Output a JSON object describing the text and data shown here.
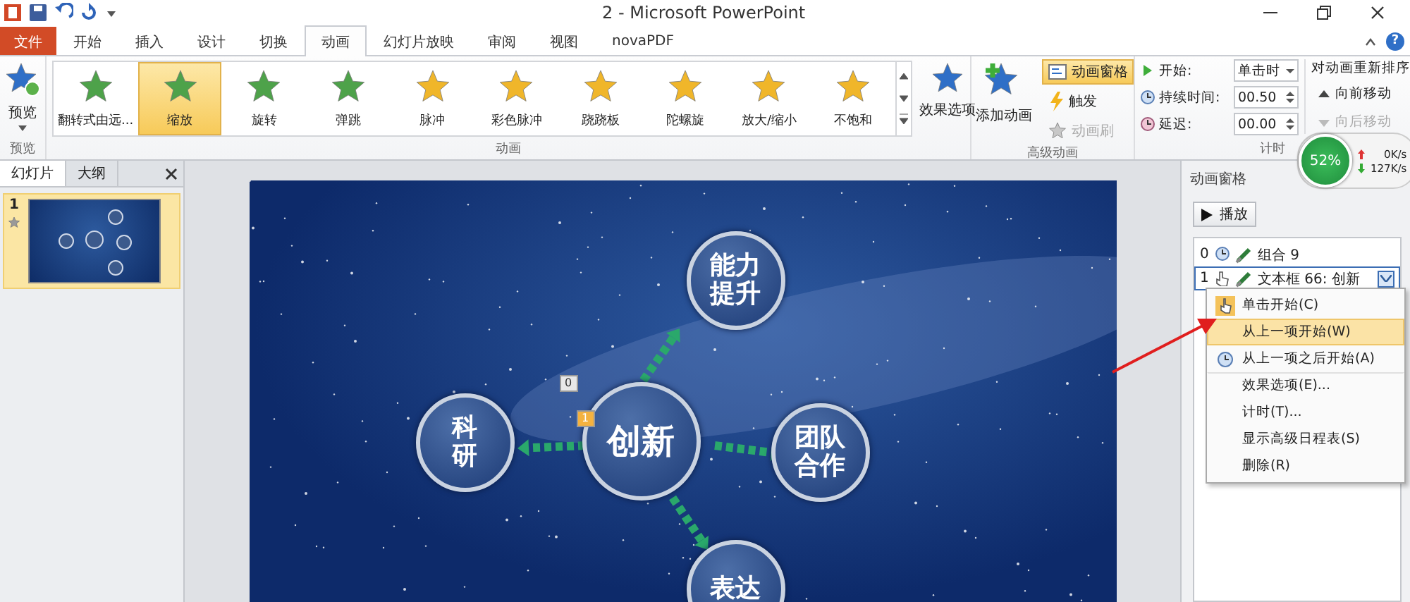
{
  "window": {
    "title": "2 - Microsoft PowerPoint"
  },
  "help": "?",
  "tabs": [
    {
      "label": "文件",
      "kind": "file",
      "selected": false
    },
    {
      "label": "开始",
      "kind": "tab",
      "selected": false
    },
    {
      "label": "插入",
      "kind": "tab",
      "selected": false
    },
    {
      "label": "设计",
      "kind": "tab",
      "selected": false
    },
    {
      "label": "切换",
      "kind": "tab",
      "selected": false
    },
    {
      "label": "动画",
      "kind": "tab",
      "selected": true
    },
    {
      "label": "幻灯片放映",
      "kind": "tab",
      "selected": false
    },
    {
      "label": "审阅",
      "kind": "tab",
      "selected": false
    },
    {
      "label": "视图",
      "kind": "tab",
      "selected": false
    },
    {
      "label": "novaPDF",
      "kind": "tab",
      "selected": false
    }
  ],
  "ribbon": {
    "preview": {
      "label": "预览",
      "group": "预览"
    },
    "gallery": {
      "group": "动画",
      "items": [
        {
          "label": "翻转式由远...",
          "kind": "entrance",
          "selected": false
        },
        {
          "label": "缩放",
          "kind": "entrance",
          "selected": true
        },
        {
          "label": "旋转",
          "kind": "entrance",
          "selected": false
        },
        {
          "label": "弹跳",
          "kind": "entrance",
          "selected": false
        },
        {
          "label": "脉冲",
          "kind": "emphasis",
          "selected": false
        },
        {
          "label": "彩色脉冲",
          "kind": "emphasis",
          "selected": false
        },
        {
          "label": "跷跷板",
          "kind": "emphasis",
          "selected": false
        },
        {
          "label": "陀螺旋",
          "kind": "emphasis",
          "selected": false
        },
        {
          "label": "放大/缩小",
          "kind": "emphasis",
          "selected": false
        },
        {
          "label": "不饱和",
          "kind": "emphasis",
          "selected": false
        }
      ]
    },
    "effect_options": "效果选项",
    "advanced": {
      "group": "高级动画",
      "add_animation": "添加动画",
      "pane_button": {
        "label": "动画窗格",
        "on": true
      },
      "trigger": "触发",
      "painter": {
        "label": "动画刷",
        "disabled": true
      }
    },
    "timing": {
      "group": "计时",
      "start_label": "开始:",
      "start_value": "单击时",
      "duration_label": "持续时间:",
      "duration_value": "00.50",
      "delay_label": "延迟:",
      "delay_value": "00.00",
      "reorder_title": "对动画重新排序",
      "move_earlier": {
        "label": "向前移动",
        "disabled": false
      },
      "move_later": {
        "label": "向后移动",
        "disabled": true
      }
    }
  },
  "slide_panel": {
    "tabs": [
      {
        "label": "幻灯片",
        "selected": true
      },
      {
        "label": "大纲",
        "selected": false
      }
    ],
    "slides": [
      {
        "number": "1",
        "selected": true
      }
    ]
  },
  "slide": {
    "nodes": [
      {
        "text": "创新",
        "kind": "center"
      },
      {
        "text": "能力提升",
        "kind": "outer"
      },
      {
        "text": "科研",
        "kind": "outer"
      },
      {
        "text": "团队合作",
        "kind": "outer"
      },
      {
        "text": "表达",
        "kind": "outer"
      }
    ],
    "tags": [
      "0",
      "1"
    ]
  },
  "animation_pane": {
    "title": "动画窗格",
    "play": "播放",
    "items": [
      {
        "number": "0",
        "kind": "after",
        "name": "组合 9",
        "selected": false
      },
      {
        "number": "1",
        "kind": "click",
        "name": "文本框 66: 创新",
        "selected": true
      }
    ],
    "menu": [
      {
        "label": "单击开始(C)",
        "kind": "click",
        "selected": false
      },
      {
        "label": "从上一项开始(W)",
        "kind": "with",
        "selected": true
      },
      {
        "label": "从上一项之后开始(A)",
        "kind": "after",
        "selected": false
      },
      {
        "label": "效果选项(E)...",
        "kind": "plain",
        "selected": false
      },
      {
        "label": "计时(T)...",
        "kind": "plain",
        "selected": false
      },
      {
        "label": "显示高级日程表(S)",
        "kind": "plain",
        "selected": false
      },
      {
        "label": "删除(R)",
        "kind": "plain",
        "selected": false
      }
    ]
  },
  "network_widget": {
    "percent": "52%",
    "upload": "0K/s",
    "download": "127K/s"
  }
}
